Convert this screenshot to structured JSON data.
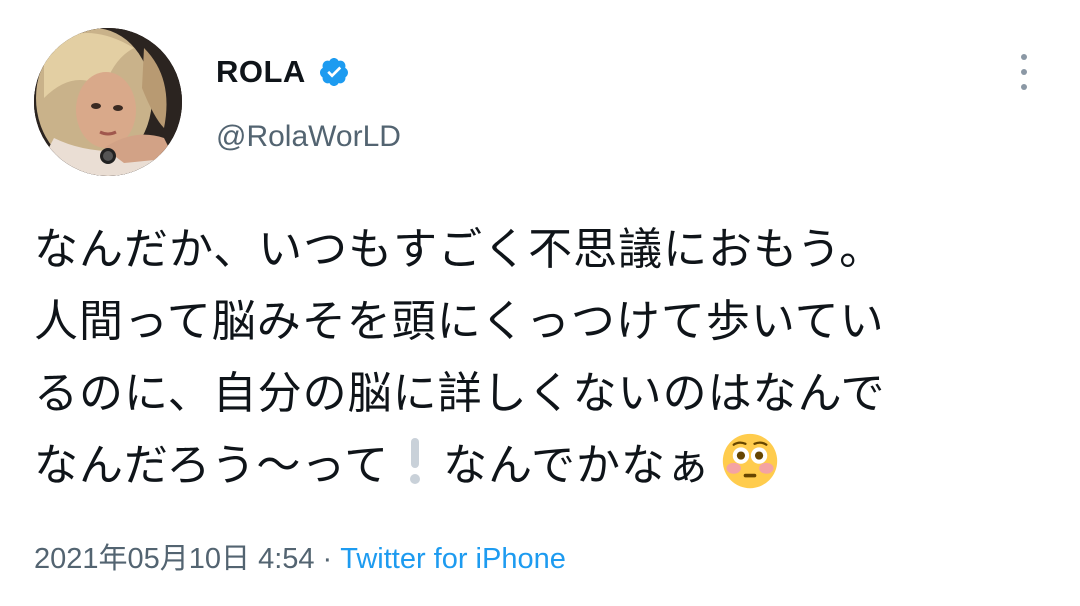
{
  "user": {
    "display_name": "ROLA",
    "verified": true,
    "handle": "@RolaWorLD"
  },
  "tweet": {
    "lines": [
      "なんだか、いつもすごく不思議におもう。",
      "人間って脳みそを頭にくっつけて歩いてい",
      "るのに、自分の脳に詳しくないのはなんで"
    ],
    "last_line_before": "なんだろう〜って",
    "last_line_after": "なんでかなぁ",
    "emoji": "flushed-face"
  },
  "meta": {
    "timestamp": "2021年05月10日 4:54",
    "separator": "·",
    "source": "Twitter for iPhone"
  },
  "colors": {
    "verified_blue": "#1d9bf0",
    "link_blue": "#1d9bf0",
    "secondary_text": "#536471"
  }
}
